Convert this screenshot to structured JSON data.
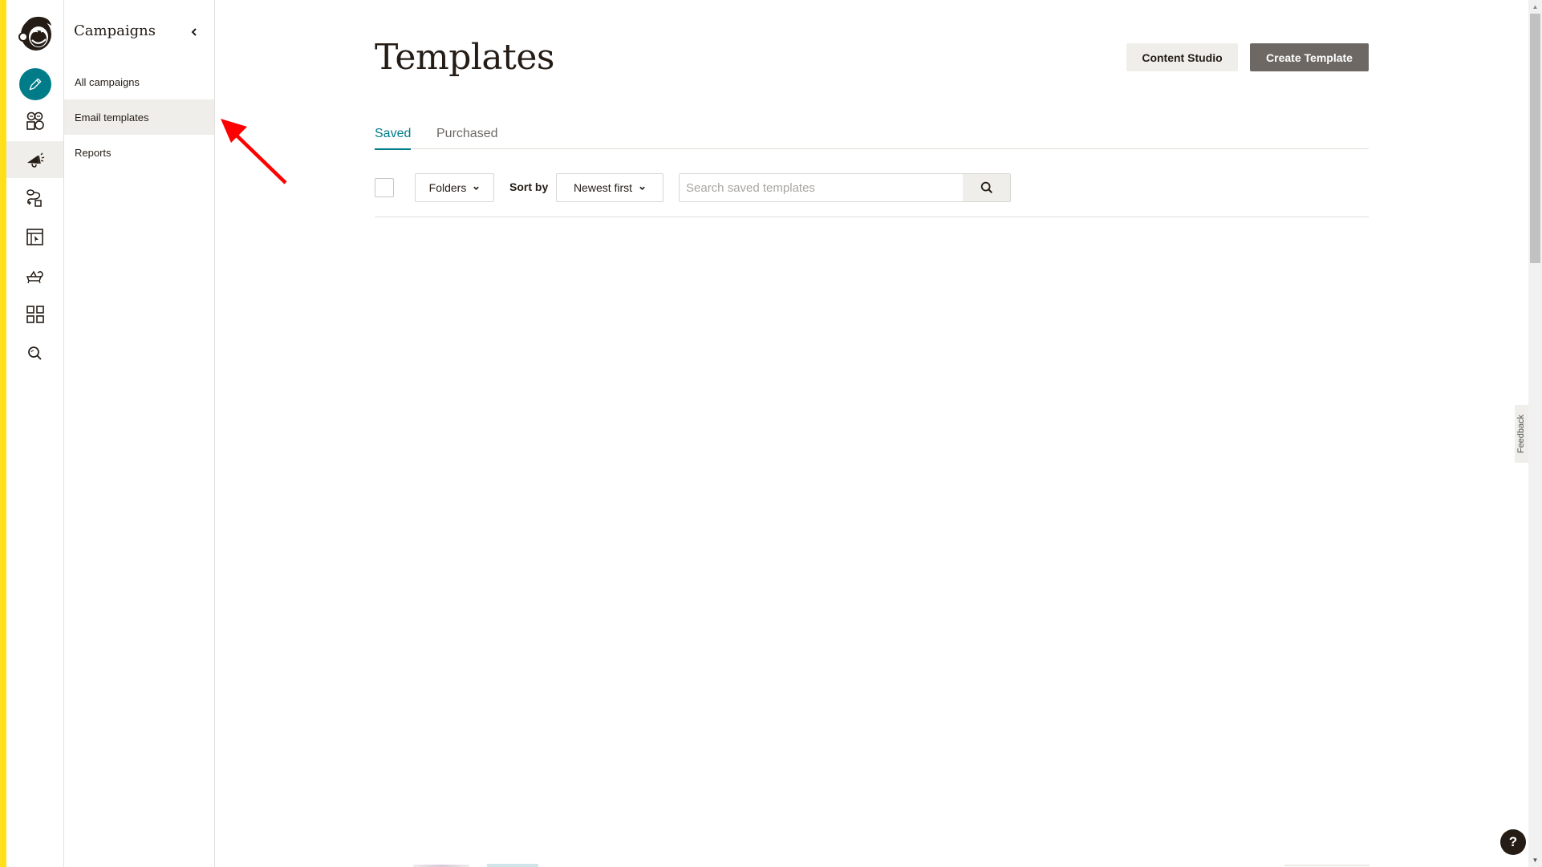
{
  "brand": {
    "strip_color": "#ffe01b",
    "accent_color": "#007c89"
  },
  "icon_rail": {
    "logo": "mailchimp-freddie-logo",
    "items": [
      {
        "name": "create",
        "icon": "pencil-icon"
      },
      {
        "name": "audience",
        "icon": "audience-icon"
      },
      {
        "name": "campaigns",
        "icon": "megaphone-icon",
        "active": true
      },
      {
        "name": "automations",
        "icon": "automation-flow-icon"
      },
      {
        "name": "website",
        "icon": "website-cursor-icon"
      },
      {
        "name": "integrations",
        "icon": "integrations-icon"
      },
      {
        "name": "content",
        "icon": "grid-icon"
      },
      {
        "name": "search",
        "icon": "search-icon"
      }
    ]
  },
  "subnav": {
    "title": "Campaigns",
    "collapse_icon": "chevron-left-icon",
    "items": [
      {
        "label": "All campaigns"
      },
      {
        "label": "Email templates",
        "active": true
      },
      {
        "label": "Reports"
      }
    ]
  },
  "annotation": {
    "type": "arrow",
    "color": "#ff0000",
    "points_to": "Email templates"
  },
  "page": {
    "title": "Templates",
    "buttons": {
      "content_studio": "Content Studio",
      "create_template": "Create Template"
    },
    "tabs": [
      {
        "label": "Saved",
        "active": true
      },
      {
        "label": "Purchased"
      }
    ],
    "filters": {
      "folders_label": "Folders",
      "sort_label": "Sort by",
      "sort_value": "Newest first",
      "search_placeholder": "Search saved templates",
      "search_value": ""
    }
  },
  "feedback_label": "Feedback",
  "help_label": "?"
}
